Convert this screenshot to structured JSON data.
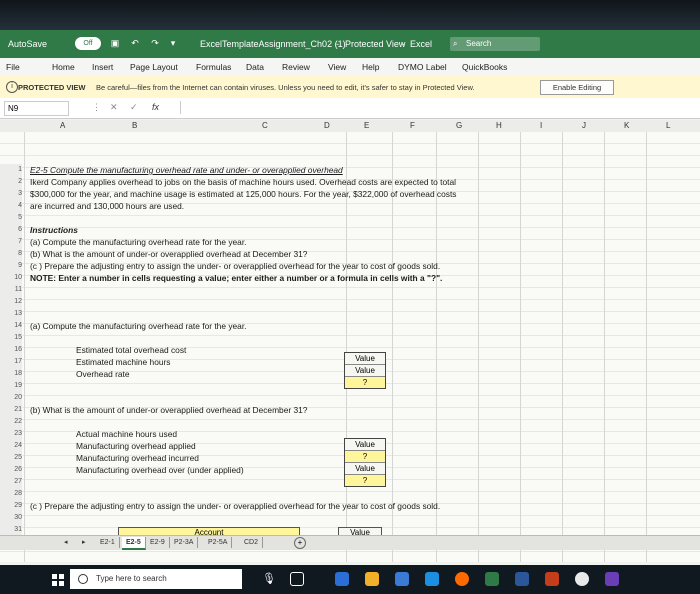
{
  "titlebar": {
    "autosave": "AutoSave",
    "toggle": "Off",
    "doc_title": "ExcelTemplateAssignment_Ch02 (1)",
    "sep": "-",
    "protected": "Protected View",
    "app": "Excel",
    "search": "Search"
  },
  "ribbon": {
    "tabs": [
      "File",
      "Home",
      "Insert",
      "Page Layout",
      "Formulas",
      "Data",
      "Review",
      "View",
      "Help",
      "DYMO Label",
      "QuickBooks"
    ]
  },
  "protected_bar": {
    "label": "PROTECTED VIEW",
    "message": "Be careful—files from the Internet can contain viruses. Unless you need to edit, it's safer to stay in Protected View.",
    "button": "Enable Editing"
  },
  "formula_bar": {
    "cell": "N9",
    "cancel": "✕",
    "enter": "✓",
    "fx": "fx"
  },
  "columns": [
    "A",
    "B",
    "C",
    "D",
    "E",
    "F",
    "G",
    "H",
    "I",
    "J",
    "K",
    "L"
  ],
  "rows": [
    {
      "n": "1",
      "text": "E2-5  Compute the manufacturing overhead rate and under- or overapplied overhead",
      "style": "ui"
    },
    {
      "n": "2",
      "text": "Ikerd Company applies overhead to jobs on the basis of machine hours used. Overhead costs are expected to total",
      "style": ""
    },
    {
      "n": "3",
      "text": "$300,000 for the year, and machine usage is estimated at 125,000 hours.  For the year, $322,000 of overhead costs",
      "style": ""
    },
    {
      "n": "4",
      "text": "are incurred and 130,000 hours are used.",
      "style": ""
    },
    {
      "n": "5",
      "text": "",
      "style": ""
    },
    {
      "n": "6",
      "text": "Instructions",
      "style": "bi"
    },
    {
      "n": "7",
      "text": "(a)  Compute the manufacturing overhead rate for the year.",
      "style": ""
    },
    {
      "n": "8",
      "text": "(b)  What is the amount of under-or overapplied overhead at December 31?",
      "style": ""
    },
    {
      "n": "9",
      "text": "(c )  Prepare the adjusting entry to assign the under- or overapplied overhead for the year to cost of goods sold.",
      "style": ""
    },
    {
      "n": "10",
      "text": "NOTE:  Enter a number in cells requesting a value; enter either a number or a formula in cells with a \"?\".",
      "style": "b"
    },
    {
      "n": "11",
      "text": "",
      "style": ""
    },
    {
      "n": "12",
      "text": "",
      "style": ""
    },
    {
      "n": "13",
      "text": "",
      "style": ""
    },
    {
      "n": "14",
      "text": "(a)   Compute the manufacturing overhead rate for the year.",
      "style": ""
    },
    {
      "n": "15",
      "text": "",
      "style": ""
    },
    {
      "n": "16",
      "text": "Estimated total overhead cost",
      "style": ""
    },
    {
      "n": "17",
      "text": "Estimated machine hours",
      "style": ""
    },
    {
      "n": "18",
      "text": "Overhead rate",
      "style": ""
    },
    {
      "n": "19",
      "text": "",
      "style": ""
    },
    {
      "n": "20",
      "text": "",
      "style": ""
    },
    {
      "n": "21",
      "text": "(b)   What is the amount of under-or overapplied overhead at December 31?",
      "style": ""
    },
    {
      "n": "22",
      "text": "",
      "style": ""
    },
    {
      "n": "23",
      "text": "Actual machine hours used",
      "style": ""
    },
    {
      "n": "24",
      "text": "Manufacturing overhead applied",
      "style": ""
    },
    {
      "n": "25",
      "text": "Manufacturing overhead incurred",
      "style": ""
    },
    {
      "n": "26",
      "text": "Manufacturing overhead over (under applied)",
      "style": ""
    },
    {
      "n": "27",
      "text": "",
      "style": ""
    },
    {
      "n": "28",
      "text": "",
      "style": ""
    },
    {
      "n": "29",
      "text": "(c )  Prepare the adjusting entry to assign the under- or overapplied overhead for the year to cost of goods sold.",
      "style": ""
    },
    {
      "n": "30",
      "text": "",
      "style": ""
    },
    {
      "n": "31",
      "text": "",
      "style": ""
    }
  ],
  "box_a": [
    "Value",
    "Value",
    "?"
  ],
  "box_b": [
    "Value",
    "?",
    "Value",
    "?"
  ],
  "entry": {
    "account": "Account",
    "value": "Value"
  },
  "sheets": [
    "E2-1",
    "E2-5",
    "E2-9",
    "P2-3A",
    "P2-5A",
    "CD2"
  ],
  "active_sheet": "E2-5",
  "taskbar": {
    "search": "Type here to search"
  }
}
